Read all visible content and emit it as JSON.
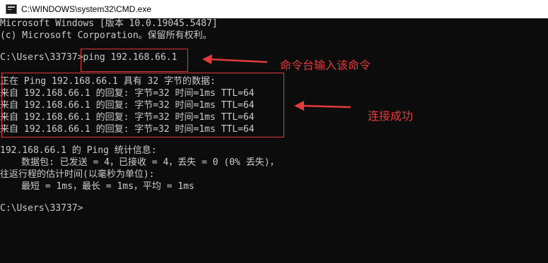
{
  "window": {
    "title": "C:\\WINDOWS\\system32\\CMD.exe"
  },
  "console": {
    "lines": [
      "Microsoft Windows [版本 10.0.19045.5487]",
      "(c) Microsoft Corporation。保留所有权利。",
      "",
      "C:\\Users\\33737>ping 192.168.66.1",
      "",
      "正在 Ping 192.168.66.1 具有 32 字节的数据:",
      "来自 192.168.66.1 的回复: 字节=32 时间=1ms TTL=64",
      "来自 192.168.66.1 的回复: 字节=32 时间=1ms TTL=64",
      "来自 192.168.66.1 的回复: 字节=32 时间=1ms TTL=64",
      "来自 192.168.66.1 的回复: 字节=32 时间=1ms TTL=64",
      "",
      "192.168.66.1 的 Ping 统计信息:",
      "数据包: 已发送 = 4，已接收 = 4，丢失 = 0 (0% 丢失)，",
      "往返行程的估计时间(以毫秒为单位):",
      "最短 = 1ms，最长 = 1ms，平均 = 1ms",
      "",
      "C:\\Users\\33737>"
    ]
  },
  "annotations": {
    "command_label": "命令台输入该命令",
    "success_label": "连接成功",
    "color": "#e23b3b"
  }
}
